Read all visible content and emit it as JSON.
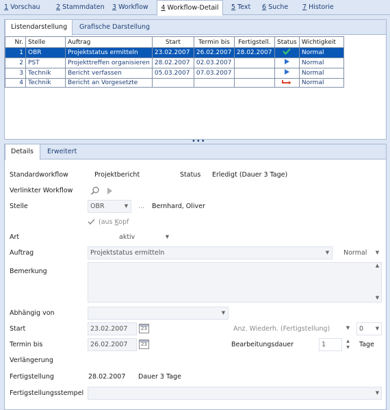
{
  "main_tabs": [
    {
      "key": "1",
      "label": " Vorschau"
    },
    {
      "key": "2",
      "label": " Stammdaten"
    },
    {
      "key": "3",
      "label": " Workflow"
    },
    {
      "key": "4",
      "label": " Workflow-Detail"
    },
    {
      "key": "5",
      "label": " Text"
    },
    {
      "key": "6",
      "label": " Suche"
    },
    {
      "key": "7",
      "label": " Historie"
    }
  ],
  "list_tabs": [
    "Listendarstellung",
    "Grafische Darstellung"
  ],
  "grid": {
    "headers": [
      "Nr.",
      "Stelle",
      "Auftrag",
      "Start",
      "Termin bis",
      "Fertigstell.",
      "Status",
      "Wichtigkeit"
    ],
    "rows": [
      {
        "nr": "1",
        "stelle": "OBR",
        "auftrag": "Projektstatus ermitteln",
        "start": "23.02.2007",
        "termin": "26.02.2007",
        "fertig": "28.02.2007",
        "status": "check-icon",
        "wichtigkeit": "Normal"
      },
      {
        "nr": "2",
        "stelle": "PST",
        "auftrag": "Projekttreffen organisieren",
        "start": "28.02.2007",
        "termin": "02.03.2007",
        "fertig": "",
        "status": "play-icon",
        "wichtigkeit": "Normal"
      },
      {
        "nr": "3",
        "stelle": "Technik",
        "auftrag": "Bericht verfassen",
        "start": "05.03.2007",
        "termin": "07.03.2007",
        "fertig": "",
        "status": "play-icon",
        "wichtigkeit": "Normal"
      },
      {
        "nr": "4",
        "stelle": "Technik",
        "auftrag": "Bericht an Vorgesetzte",
        "start": "",
        "termin": "",
        "fertig": "",
        "status": "return-arrow-icon",
        "wichtigkeit": "Normal"
      }
    ]
  },
  "detail_tabs": [
    "Details",
    "Erweitert"
  ],
  "details": {
    "standardworkflow_label": "Standardworkflow",
    "standardworkflow_value": "Projektbericht",
    "status_label": "Status",
    "status_value": "Erledigt (Dauer 3 Tage)",
    "verlinkter_label": "Verlinkter Workflow",
    "stelle_label": "Stelle",
    "stelle_value": "OBR",
    "stelle_ellipsis": "...",
    "stelle_person": "Bernhard, Oliver",
    "aus_kopf_prefix": "(aus ",
    "aus_kopf_key": "K",
    "aus_kopf_suffix": "opf",
    "art_label": "Art",
    "art_value": "aktiv",
    "auftrag_label": "Auftrag",
    "auftrag_value": "Projektstatus ermitteln",
    "wichtigkeit_value": "Normal",
    "bemerkung_label": "Bemerkung",
    "abhaengig_label": "Abhängig von",
    "start_label": "Start",
    "start_value": "23.02.2007",
    "cal_day": "23",
    "anz_label": "Anz. Wiederh. (Fertigstellung)",
    "anz_value": "0",
    "termin_label": "Termin bis",
    "termin_value": "26.02.2007",
    "bearb_label": "Bearbeitungsdauer",
    "bearb_value": "1",
    "tage_label": "Tage",
    "verlaengerung_label": "Verlängerung",
    "fertig_label": "Fertigstellung",
    "fertig_value": "28.02.2007",
    "fertig_dauer": "Dauer 3 Tage",
    "stempel_label": "Fertigstellungsstempel"
  },
  "colors": {
    "selection": "#0a58b6",
    "link_text": "#1f3f78",
    "check": "#2e9a48",
    "play": "#2f6fd0",
    "return_arrow": "#d8432c"
  }
}
